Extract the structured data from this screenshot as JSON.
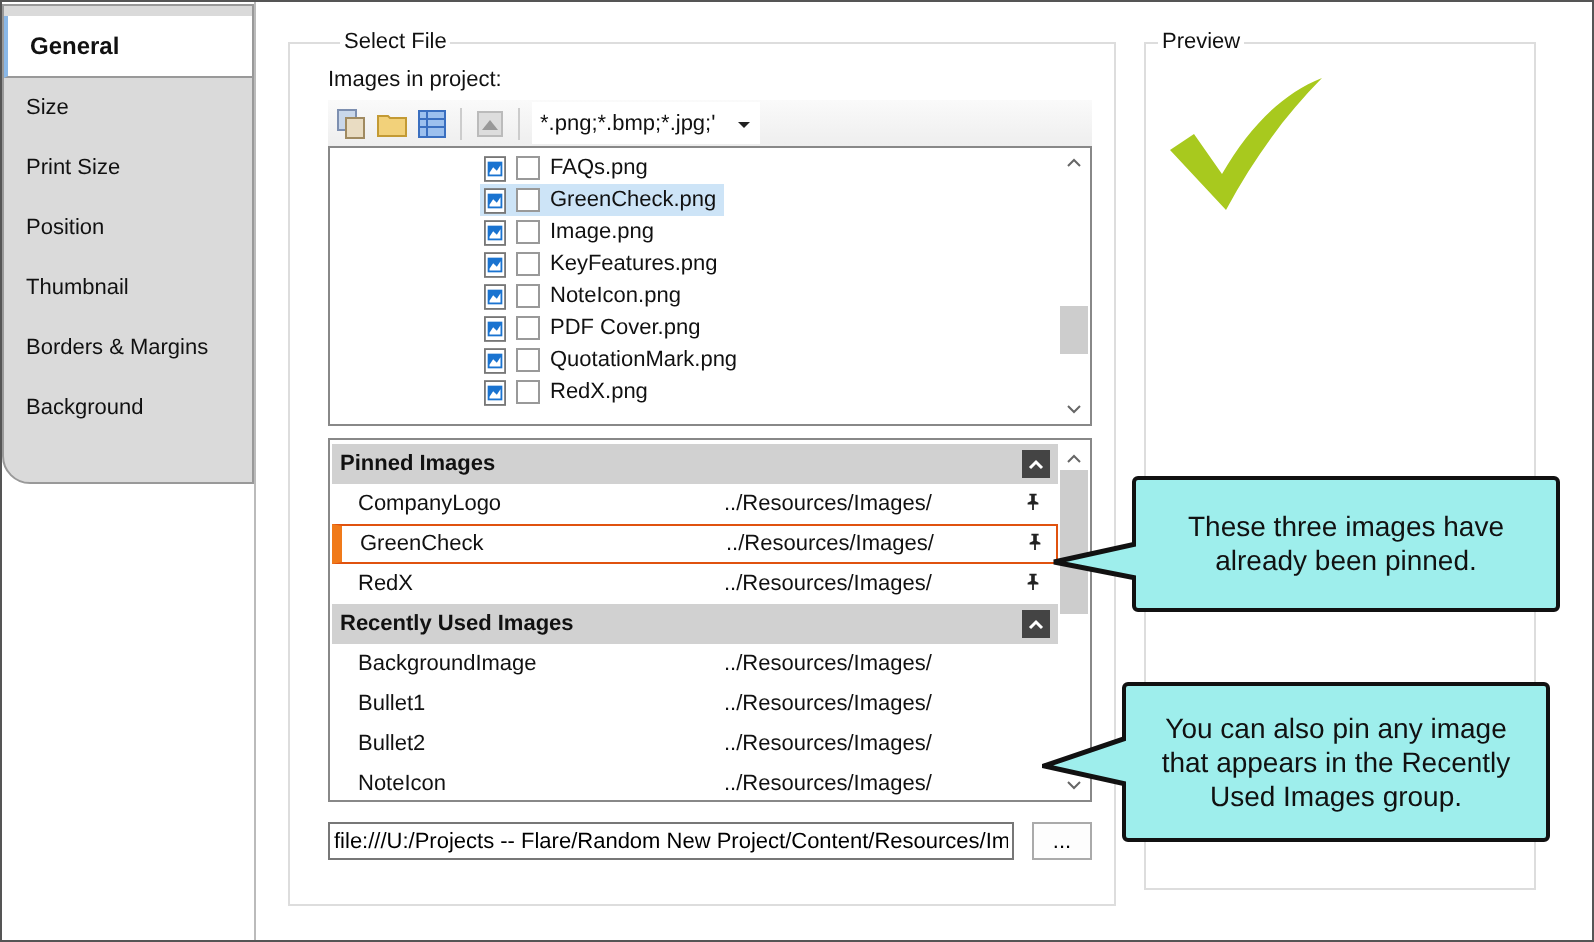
{
  "tabs": [
    {
      "label": "General",
      "selected": true
    },
    {
      "label": "Size",
      "selected": false
    },
    {
      "label": "Print Size",
      "selected": false
    },
    {
      "label": "Position",
      "selected": false
    },
    {
      "label": "Thumbnail",
      "selected": false
    },
    {
      "label": "Borders & Margins",
      "selected": false
    },
    {
      "label": "Background",
      "selected": false
    }
  ],
  "select_file": {
    "title": "Select File",
    "list_label": "Images in project:",
    "filter": "*.png;*.bmp;*.jpg;'",
    "files": [
      {
        "name": "FAQs.png",
        "checked": false,
        "selected": false
      },
      {
        "name": "GreenCheck.png",
        "checked": false,
        "selected": true
      },
      {
        "name": "Image.png",
        "checked": false,
        "selected": false
      },
      {
        "name": "KeyFeatures.png",
        "checked": false,
        "selected": false
      },
      {
        "name": "NoteIcon.png",
        "checked": false,
        "selected": false
      },
      {
        "name": "PDF Cover.png",
        "checked": false,
        "selected": false
      },
      {
        "name": "QuotationMark.png",
        "checked": false,
        "selected": false
      },
      {
        "name": "RedX.png",
        "checked": false,
        "selected": false
      }
    ],
    "groups": [
      {
        "title": "Pinned Images",
        "expanded": true,
        "items": [
          {
            "name": "CompanyLogo",
            "path": "../Resources/Images/",
            "pinned": true,
            "selected": false
          },
          {
            "name": "GreenCheck",
            "path": "../Resources/Images/",
            "pinned": true,
            "selected": true
          },
          {
            "name": "RedX",
            "path": "../Resources/Images/",
            "pinned": true,
            "selected": false
          }
        ]
      },
      {
        "title": "Recently Used Images",
        "expanded": true,
        "items": [
          {
            "name": "BackgroundImage",
            "path": "../Resources/Images/",
            "pinned": false,
            "selected": false
          },
          {
            "name": "Bullet1",
            "path": "../Resources/Images/",
            "pinned": false,
            "selected": false
          },
          {
            "name": "Bullet2",
            "path": "../Resources/Images/",
            "pinned": false,
            "selected": false
          },
          {
            "name": "NoteIcon",
            "path": "../Resources/Images/",
            "pinned": false,
            "selected": false
          }
        ]
      }
    ],
    "path_value": "file:///U:/Projects -- Flare/Random New Project/Content/Resources/Im",
    "browse_button": "..."
  },
  "preview": {
    "title": "Preview"
  },
  "callouts": [
    "These three images have already been pinned.",
    "You can also pin any image that appears in the Recently Used Images group."
  ]
}
